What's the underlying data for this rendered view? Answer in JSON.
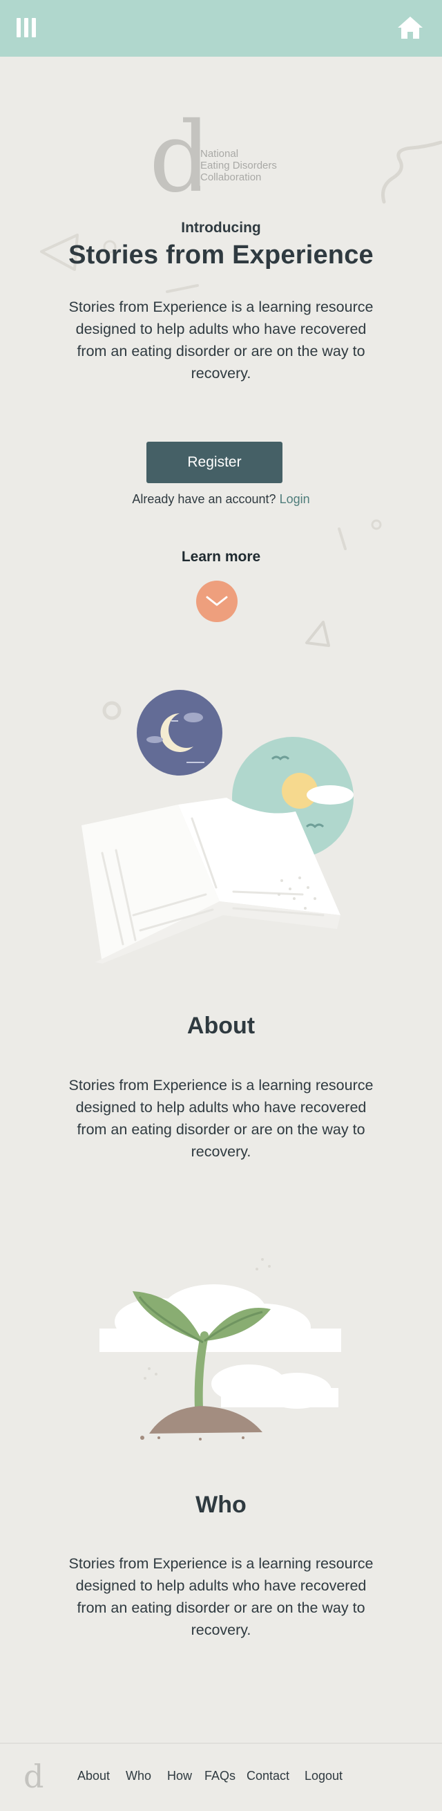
{
  "header": {
    "menu_icon": "menu-bars-icon",
    "home_icon": "home-icon",
    "background": "#b0d7cd"
  },
  "logo": {
    "letter": "d",
    "lines": [
      "National",
      "Eating Disorders",
      "Collaboration"
    ]
  },
  "hero": {
    "kicker": "Introducing",
    "title": "Stories from Experience",
    "description": "Stories from Experience is a learning resource designed to help adults who have recovered from an eating disorder or are on the way to recovery."
  },
  "actions": {
    "register_label": "Register",
    "account_prompt": "Already have an account?",
    "login_label": "Login",
    "learn_more": "Learn more",
    "scroll_icon": "chevron-down-icon"
  },
  "about": {
    "title": "About",
    "description": "Stories from Experience is a learning resource designed to help adults who have recovered from an eating disorder or are on the way to recovery."
  },
  "who": {
    "title": "Who",
    "description": "Stories from Experience is a learning resource designed to help adults who have recovered from an eating disorder or are on the way to recovery."
  },
  "footer": {
    "logo_letter": "d",
    "nav": [
      "About",
      "Who",
      "How",
      "FAQs",
      "Contact",
      "Logout"
    ]
  },
  "colors": {
    "background": "#ecebe7",
    "primary_button": "#456066",
    "accent": "#ee9f7d",
    "link": "#4f7d7b"
  }
}
